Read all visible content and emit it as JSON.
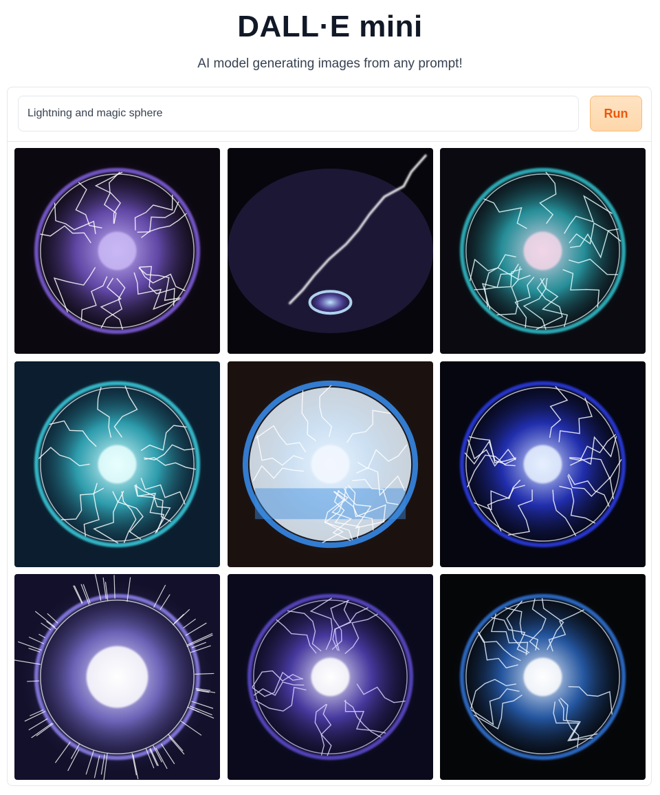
{
  "header": {
    "title": "DALL·E mini",
    "subtitle": "AI model generating images from any prompt!"
  },
  "prompt": {
    "value": "Lightning and magic sphere",
    "placeholder": ""
  },
  "run_button": {
    "label": "Run"
  },
  "colors": {
    "run_button_text": "#ea580c",
    "run_button_bg": "#fed7aa",
    "border": "#e5e7eb"
  },
  "gallery": {
    "images": [
      {
        "bg": "#0c0810",
        "glow": "#7c5cd6",
        "core": "#c9b8f5",
        "bolt": "#ffffff",
        "style": "ring"
      },
      {
        "bg": "#07060c",
        "glow": "#5a4ab0",
        "core": "#bfe6ff",
        "bolt": "#ffffff",
        "style": "bolt"
      },
      {
        "bg": "#0a0a10",
        "glow": "#2fb9c4",
        "core": "#f2d6e8",
        "bolt": "#e6ffff",
        "style": "orb"
      },
      {
        "bg": "#0b1d2e",
        "glow": "#39c6d6",
        "core": "#e8ffff",
        "bolt": "#ffffff",
        "style": "orb"
      },
      {
        "bg": "#1b1210",
        "glow": "#2f86d8",
        "core": "#f4f8ff",
        "bolt": "#ffffff",
        "style": "disc"
      },
      {
        "bg": "#05060f",
        "glow": "#2a3be0",
        "core": "#e6f0ff",
        "bolt": "#ffffff",
        "style": "orb"
      },
      {
        "bg": "#12102a",
        "glow": "#8a7ee6",
        "core": "#ffffff",
        "bolt": "#ffffff",
        "style": "burst"
      },
      {
        "bg": "#0a0a1c",
        "glow": "#5a48c8",
        "core": "#ffffff",
        "bolt": "#d9d2ff",
        "style": "ring"
      },
      {
        "bg": "#050608",
        "glow": "#2e6fd0",
        "core": "#ffffff",
        "bolt": "#e6f2ff",
        "style": "orb"
      }
    ]
  }
}
